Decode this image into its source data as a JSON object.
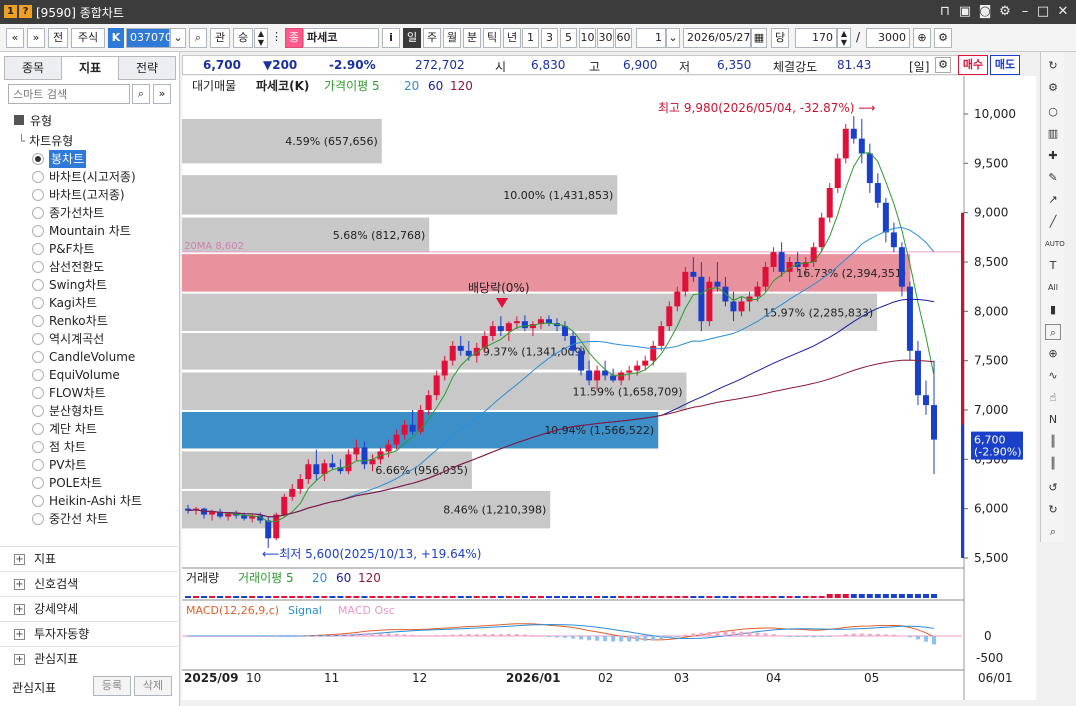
{
  "window": {
    "code": "9590",
    "title": "[9590] 종합차트",
    "icon_num": "1",
    "icon_q": "?"
  },
  "toolbar": {
    "nav_prev": "«",
    "nav_down": "»",
    "prev_btn": "전",
    "market": "주식",
    "k_badge": "K",
    "stock_code": "037070",
    "search_icon": "⌕",
    "gwan": "관",
    "sang": "승",
    "stock_badge": "종",
    "stock_name": "파세코",
    "info_btn": "i",
    "periods": [
      "일",
      "주",
      "월",
      "분",
      "틱",
      "년"
    ],
    "active_period": "일",
    "intervals": [
      "1",
      "3",
      "5",
      "10",
      "30",
      "60"
    ],
    "interval_value": "1",
    "date": "2026/05/27",
    "dang": "당",
    "count": "170",
    "slash": "/",
    "total": "3000"
  },
  "leftpanel": {
    "tabs": [
      "종목",
      "지표",
      "전략"
    ],
    "active_tab": "지표",
    "search_placeholder": "스마트 검색",
    "type_header": "유형",
    "chart_type_header": "차트유형",
    "chart_types": [
      "봉차트",
      "바차트(시고저종)",
      "바차트(고저종)",
      "종가선차트",
      "Mountain 차트",
      "P&F차트",
      "삼선전환도",
      "Swing차트",
      "Kagi차트",
      "Renko차트",
      "역시계곡선",
      "CandleVolume",
      "EquiVolume",
      "FLOW차트",
      "분산형차트",
      "계단 차트",
      "점 차트",
      "PV차트",
      "POLE차트",
      "Heikin-Ashi 차트",
      "중간선 차트"
    ],
    "selected_type": "봉차트",
    "sections": [
      "지표",
      "신호검색",
      "강세약세",
      "투자자동향",
      "관심지표"
    ],
    "fav_label": "관심지표",
    "register_btn": "등록",
    "delete_btn": "삭제"
  },
  "infobar": {
    "price": "6,700",
    "change": "▼200",
    "change_pct": "-2.90%",
    "volume": "272,702",
    "open_label": "시",
    "open": "6,830",
    "high_label": "고",
    "high": "6,900",
    "low_label": "저",
    "low": "6,350",
    "strength_label": "체결강도",
    "strength": "81.43",
    "period_label": "[일]",
    "buy_btn": "매수",
    "sell_btn": "매도"
  },
  "chart_data": {
    "type": "candlestick",
    "legend": [
      "대기매물",
      "파세코(K)",
      "가격이평 5",
      "20",
      "60",
      "120"
    ],
    "ylim": [
      5500,
      10000
    ],
    "yticks": [
      "10,000",
      "9,500",
      "9,000",
      "8,500",
      "8,000",
      "7,500",
      "7,000",
      "6,500",
      "6,000",
      "5,500"
    ],
    "x_labels": [
      "2025/09",
      "10",
      "11",
      "12",
      "2026/01",
      "02",
      "03",
      "04",
      "05",
      "06/01"
    ],
    "annotations": {
      "high": "최고 9,980(2026/05/04, -32.87%)",
      "low": "최저 5,600(2025/10/13, +19.64%)",
      "dividend": "배당락(0%)",
      "ma20": "20MA 8,602",
      "current_price": "6,700",
      "current_pct": "(-2.90%)"
    },
    "volume_profile": [
      {
        "label": "4.59% (657,656)",
        "price_low": 9500,
        "price_high": 9950
      },
      {
        "label": "10.00% (1,431,853)",
        "price_low": 8980,
        "price_high": 9380
      },
      {
        "label": "5.68% (812,768)",
        "price_low": 8600,
        "price_high": 8950
      },
      {
        "label": "16.73% (2,394,351)",
        "price_low": 8200,
        "price_high": 8580
      },
      {
        "label": "15.97% (2,285,833)",
        "price_low": 7800,
        "price_high": 8180
      },
      {
        "label": "9.37% (1,341,009)",
        "price_low": 7410,
        "price_high": 7780
      },
      {
        "label": "11.59% (1,658,709)",
        "price_low": 7000,
        "price_high": 7380
      },
      {
        "label": "10.94% (1,566,522)",
        "price_low": 6610,
        "price_high": 6980
      },
      {
        "label": "6.66% (956,035)",
        "price_low": 6200,
        "price_high": 6580
      },
      {
        "label": "8.46% (1,210,398)",
        "price_low": 5800,
        "price_high": 6180
      }
    ],
    "candles": [
      [
        6000,
        6040,
        5950,
        5980
      ],
      [
        5980,
        6020,
        5940,
        6000
      ],
      [
        6000,
        6010,
        5900,
        5940
      ],
      [
        5940,
        5990,
        5880,
        5970
      ],
      [
        5970,
        6000,
        5900,
        5920
      ],
      [
        5920,
        5960,
        5880,
        5950
      ],
      [
        5950,
        5980,
        5900,
        5930
      ],
      [
        5930,
        5960,
        5880,
        5900
      ],
      [
        5900,
        5950,
        5860,
        5930
      ],
      [
        5930,
        5960,
        5850,
        5880
      ],
      [
        5880,
        5920,
        5600,
        5700
      ],
      [
        5700,
        5960,
        5680,
        5940
      ],
      [
        5940,
        6150,
        5920,
        6120
      ],
      [
        6120,
        6250,
        6080,
        6200
      ],
      [
        6200,
        6350,
        6150,
        6300
      ],
      [
        6300,
        6500,
        6250,
        6450
      ],
      [
        6450,
        6600,
        6280,
        6350
      ],
      [
        6350,
        6500,
        6280,
        6460
      ],
      [
        6460,
        6550,
        6400,
        6420
      ],
      [
        6420,
        6500,
        6350,
        6380
      ],
      [
        6380,
        6600,
        6350,
        6550
      ],
      [
        6550,
        6700,
        6480,
        6620
      ],
      [
        6620,
        6680,
        6400,
        6450
      ],
      [
        6450,
        6550,
        6380,
        6500
      ],
      [
        6500,
        6620,
        6450,
        6580
      ],
      [
        6580,
        6700,
        6520,
        6650
      ],
      [
        6650,
        6800,
        6600,
        6750
      ],
      [
        6750,
        6900,
        6700,
        6850
      ],
      [
        6850,
        7000,
        6750,
        6780
      ],
      [
        6780,
        7050,
        6750,
        7000
      ],
      [
        7000,
        7200,
        6950,
        7150
      ],
      [
        7150,
        7400,
        7100,
        7350
      ],
      [
        7350,
        7550,
        7300,
        7500
      ],
      [
        7500,
        7700,
        7450,
        7650
      ],
      [
        7650,
        7750,
        7550,
        7600
      ],
      [
        7600,
        7700,
        7500,
        7550
      ],
      [
        7550,
        7680,
        7480,
        7630
      ],
      [
        7630,
        7800,
        7580,
        7750
      ],
      [
        7750,
        7900,
        7700,
        7850
      ],
      [
        7850,
        7950,
        7750,
        7800
      ],
      [
        7800,
        7900,
        7700,
        7880
      ],
      [
        7880,
        7950,
        7820,
        7900
      ],
      [
        7900,
        7960,
        7800,
        7830
      ],
      [
        7830,
        7900,
        7750,
        7870
      ],
      [
        7870,
        7950,
        7820,
        7920
      ],
      [
        7920,
        7960,
        7850,
        7880
      ],
      [
        7880,
        7930,
        7800,
        7850
      ],
      [
        7850,
        7900,
        7700,
        7750
      ],
      [
        7750,
        7800,
        7550,
        7600
      ],
      [
        7600,
        7650,
        7350,
        7400
      ],
      [
        7400,
        7500,
        7250,
        7300
      ],
      [
        7300,
        7450,
        7200,
        7400
      ],
      [
        7400,
        7500,
        7300,
        7350
      ],
      [
        7350,
        7420,
        7280,
        7300
      ],
      [
        7300,
        7400,
        7250,
        7380
      ],
      [
        7380,
        7450,
        7300,
        7400
      ],
      [
        7400,
        7500,
        7350,
        7450
      ],
      [
        7450,
        7550,
        7400,
        7500
      ],
      [
        7500,
        7700,
        7450,
        7650
      ],
      [
        7650,
        7900,
        7600,
        7850
      ],
      [
        7850,
        8100,
        7800,
        8050
      ],
      [
        8050,
        8250,
        8000,
        8200
      ],
      [
        8200,
        8450,
        8150,
        8400
      ],
      [
        8400,
        8550,
        8300,
        8350
      ],
      [
        8350,
        8500,
        7800,
        7900
      ],
      [
        7900,
        8350,
        7850,
        8300
      ],
      [
        8300,
        8500,
        8200,
        8250
      ],
      [
        8250,
        8350,
        8050,
        8100
      ],
      [
        8100,
        8200,
        7900,
        8000
      ],
      [
        8000,
        8150,
        7950,
        8100
      ],
      [
        8100,
        8200,
        8000,
        8150
      ],
      [
        8150,
        8300,
        8100,
        8250
      ],
      [
        8250,
        8500,
        8200,
        8450
      ],
      [
        8450,
        8650,
        8400,
        8600
      ],
      [
        8600,
        8700,
        8350,
        8400
      ],
      [
        8400,
        8550,
        8300,
        8500
      ],
      [
        8500,
        8600,
        8400,
        8450
      ],
      [
        8450,
        8550,
        8350,
        8500
      ],
      [
        8500,
        8700,
        8450,
        8650
      ],
      [
        8650,
        9000,
        8600,
        8950
      ],
      [
        8950,
        9300,
        8900,
        9250
      ],
      [
        9250,
        9600,
        9200,
        9550
      ],
      [
        9550,
        9900,
        9500,
        9850
      ],
      [
        9850,
        9980,
        9700,
        9750
      ],
      [
        9750,
        9950,
        9500,
        9600
      ],
      [
        9600,
        9700,
        9200,
        9300
      ],
      [
        9300,
        9400,
        9050,
        9100
      ],
      [
        9100,
        9150,
        8700,
        8800
      ],
      [
        8800,
        8900,
        8600,
        8650
      ],
      [
        8650,
        8700,
        8150,
        8250
      ],
      [
        8250,
        8300,
        7500,
        7600
      ],
      [
        7600,
        7700,
        7050,
        7150
      ],
      [
        7150,
        7300,
        6950,
        7050
      ],
      [
        7050,
        7500,
        6350,
        6700
      ]
    ],
    "volume_panel": {
      "legend": [
        "거래량",
        "거래이평 5",
        "20",
        "60",
        "120"
      ]
    },
    "macd_panel": {
      "legend": [
        "MACD(12,26,9,c)",
        "Signal",
        "MACD Osc"
      ],
      "yticks": [
        "0",
        "-500"
      ]
    }
  },
  "colors": {
    "up": "#e0103a",
    "down": "#1a3fc8",
    "ma5": "#2e9b2e",
    "ma20": "#2a8fd8",
    "ma60": "#1a1aa0",
    "ma120": "#8b1a3a"
  }
}
